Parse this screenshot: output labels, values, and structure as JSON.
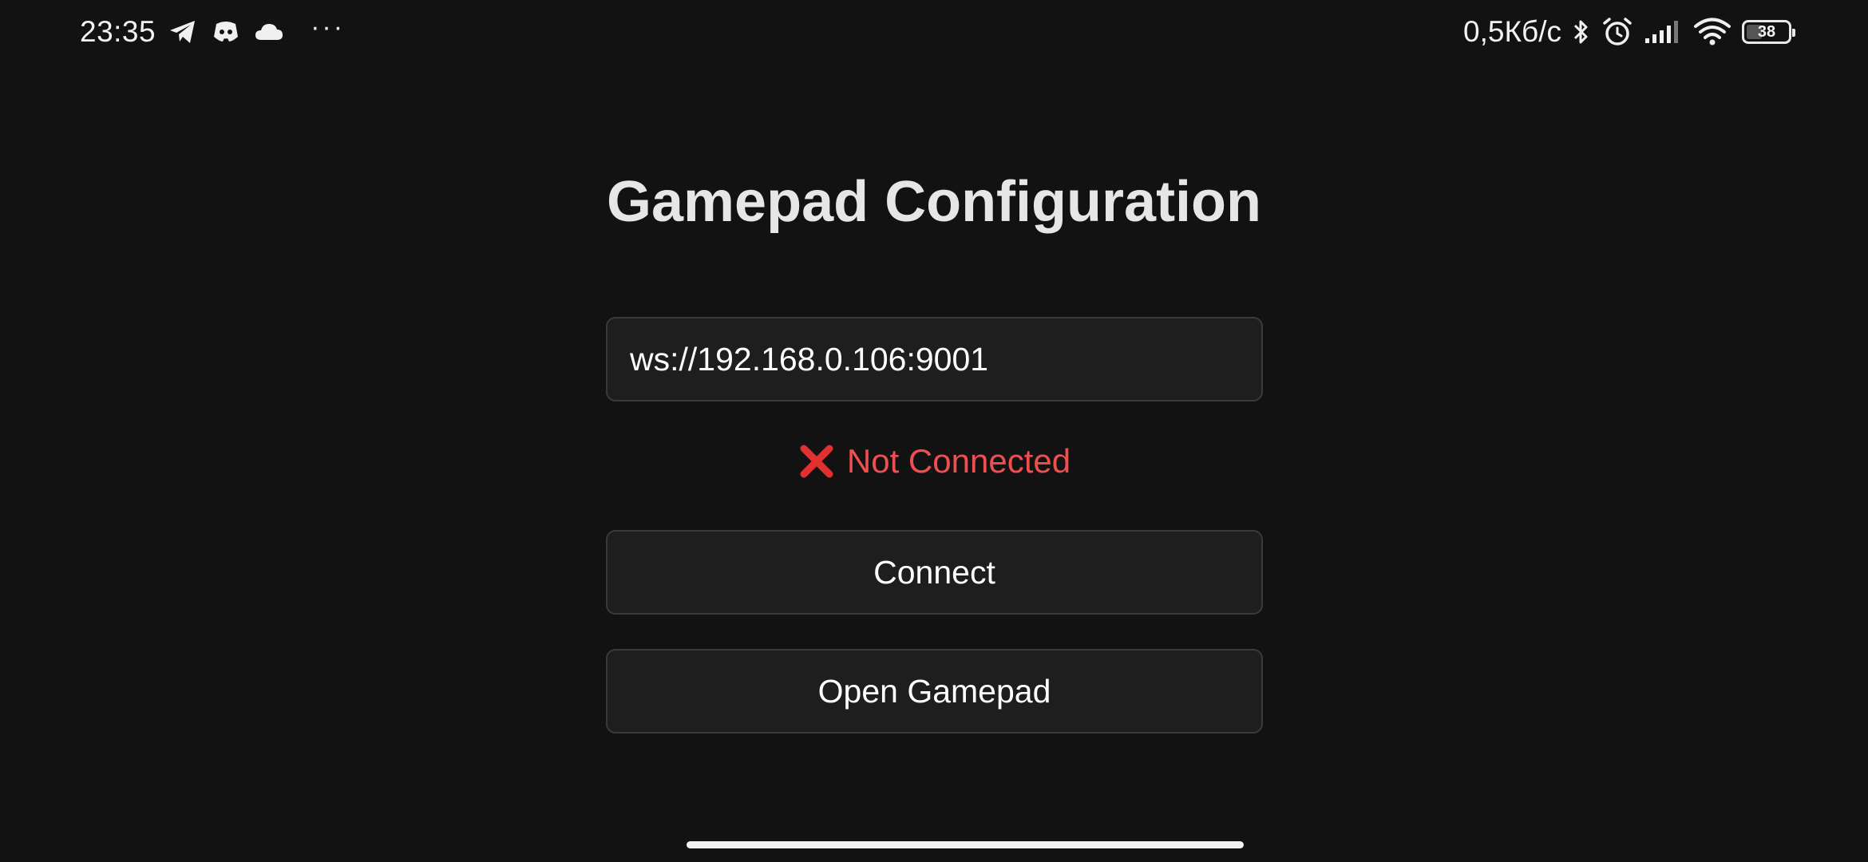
{
  "status_bar": {
    "time": "23:35",
    "left_icons": [
      "telegram-icon",
      "discord-icon",
      "cloud-icon"
    ],
    "more": "···",
    "net_speed": "0,5Кб/с",
    "right_icons": [
      "bluetooth-icon",
      "alarm-icon",
      "signal-icon",
      "wifi-icon"
    ],
    "battery": "38",
    "battery_level": 0.38
  },
  "main": {
    "title": "Gamepad Configuration",
    "url_input": {
      "value": "ws://192.168.0.106:9001"
    },
    "status": {
      "icon": "cross-mark-icon",
      "text": "Not Connected",
      "color": "#ef4f4f"
    },
    "buttons": {
      "connect": "Connect",
      "open_gamepad": "Open Gamepad"
    }
  },
  "colors": {
    "background": "#121212",
    "surface": "#1e1e1e",
    "border": "#3a3a3a",
    "error": "#ef4f4f"
  }
}
